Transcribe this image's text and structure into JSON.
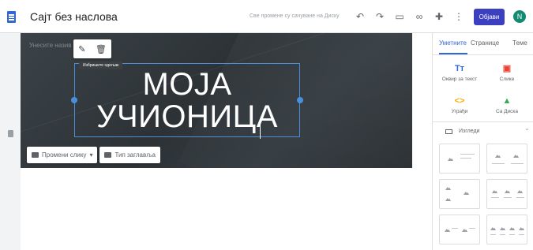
{
  "topbar": {
    "title": "Сајт без наслова",
    "save_status": "Све промене су сачуване на Диску",
    "publish_label": "Објави",
    "avatar_letter": "N"
  },
  "canvas": {
    "site_name_placeholder": "Унесите назив",
    "tooltip": "Избришите одељак",
    "header_title_line1": "МОЈА",
    "header_title_line2": "УЧИОНИЦА",
    "change_image_label": "Промени слику",
    "header_type_label": "Тип заглавља"
  },
  "panel": {
    "tabs": [
      "Уметните",
      "Странице",
      "Теме"
    ],
    "insert_items": [
      {
        "label": "Оквир за текст",
        "icon": "Tт",
        "color": "#3367d6"
      },
      {
        "label": "Слике",
        "icon": "▣",
        "color": "#ea4335"
      },
      {
        "label": "Уграђи",
        "icon": "<>",
        "color": "#f9ab00"
      },
      {
        "label": "Са Диска",
        "icon": "▲",
        "color": "#34a853"
      }
    ],
    "layouts_label": "Изгледи"
  }
}
